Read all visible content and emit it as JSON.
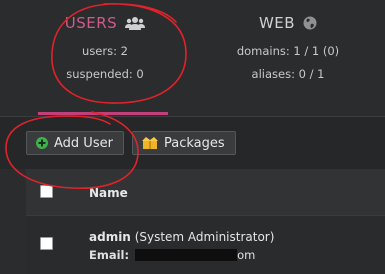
{
  "stats": {
    "users": {
      "title": "USERS",
      "icon": "users-icon",
      "lines": [
        "users: 2",
        "suspended: 0"
      ]
    },
    "web": {
      "title": "WEB",
      "icon": "globe-icon",
      "lines": [
        "domains: 1 / 1 (0)",
        "aliases: 0 / 1"
      ]
    }
  },
  "toolbar": {
    "add_user_label": "Add User",
    "packages_label": "Packages"
  },
  "table": {
    "columns": [
      "Name"
    ],
    "rows": [
      {
        "username": "admin",
        "role": "(System Administrator)",
        "email_label": "Email:",
        "email_suffix": "om"
      }
    ]
  },
  "colors": {
    "accent": "#c14079",
    "annotation": "#e0232b",
    "background": "#2b2c2d"
  }
}
